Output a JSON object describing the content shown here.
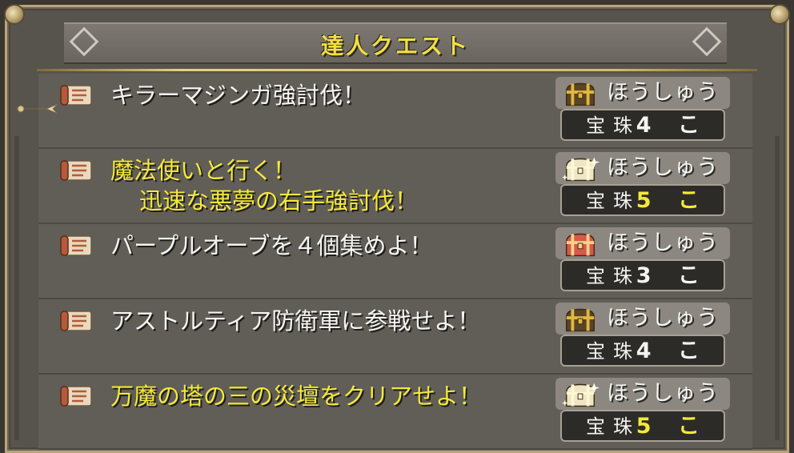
{
  "window": {
    "title": "達人クエスト"
  },
  "reward_label": "ほうしゅう",
  "quests": [
    {
      "name_lines": [
        "キラーマジンガ強討伐！"
      ],
      "highlight": false,
      "chest": "gold",
      "item": "宝珠",
      "count": "4",
      "unit": "こ",
      "selected": true
    },
    {
      "name_lines": [
        "魔法使いと行く！",
        "迅速な悪夢の右手強討伐！"
      ],
      "highlight": true,
      "chest": "shiny",
      "item": "宝珠",
      "count": "5",
      "unit": "こ",
      "selected": false
    },
    {
      "name_lines": [
        "パープルオーブを４個集めよ！"
      ],
      "highlight": false,
      "chest": "red",
      "item": "宝珠",
      "count": "3",
      "unit": "こ",
      "selected": false
    },
    {
      "name_lines": [
        "アストルティア防衛軍に参戦せよ！"
      ],
      "highlight": false,
      "chest": "gold",
      "item": "宝珠",
      "count": "4",
      "unit": "こ",
      "selected": false
    },
    {
      "name_lines": [
        "万魔の塔の三の災壇をクリアせよ！"
      ],
      "highlight": true,
      "chest": "shiny",
      "item": "宝珠",
      "count": "5",
      "unit": "こ",
      "selected": false
    }
  ],
  "colors": {
    "highlight": "#f3e93a",
    "text": "#f4f4f2",
    "accent_gold": "#d6bb6d"
  }
}
